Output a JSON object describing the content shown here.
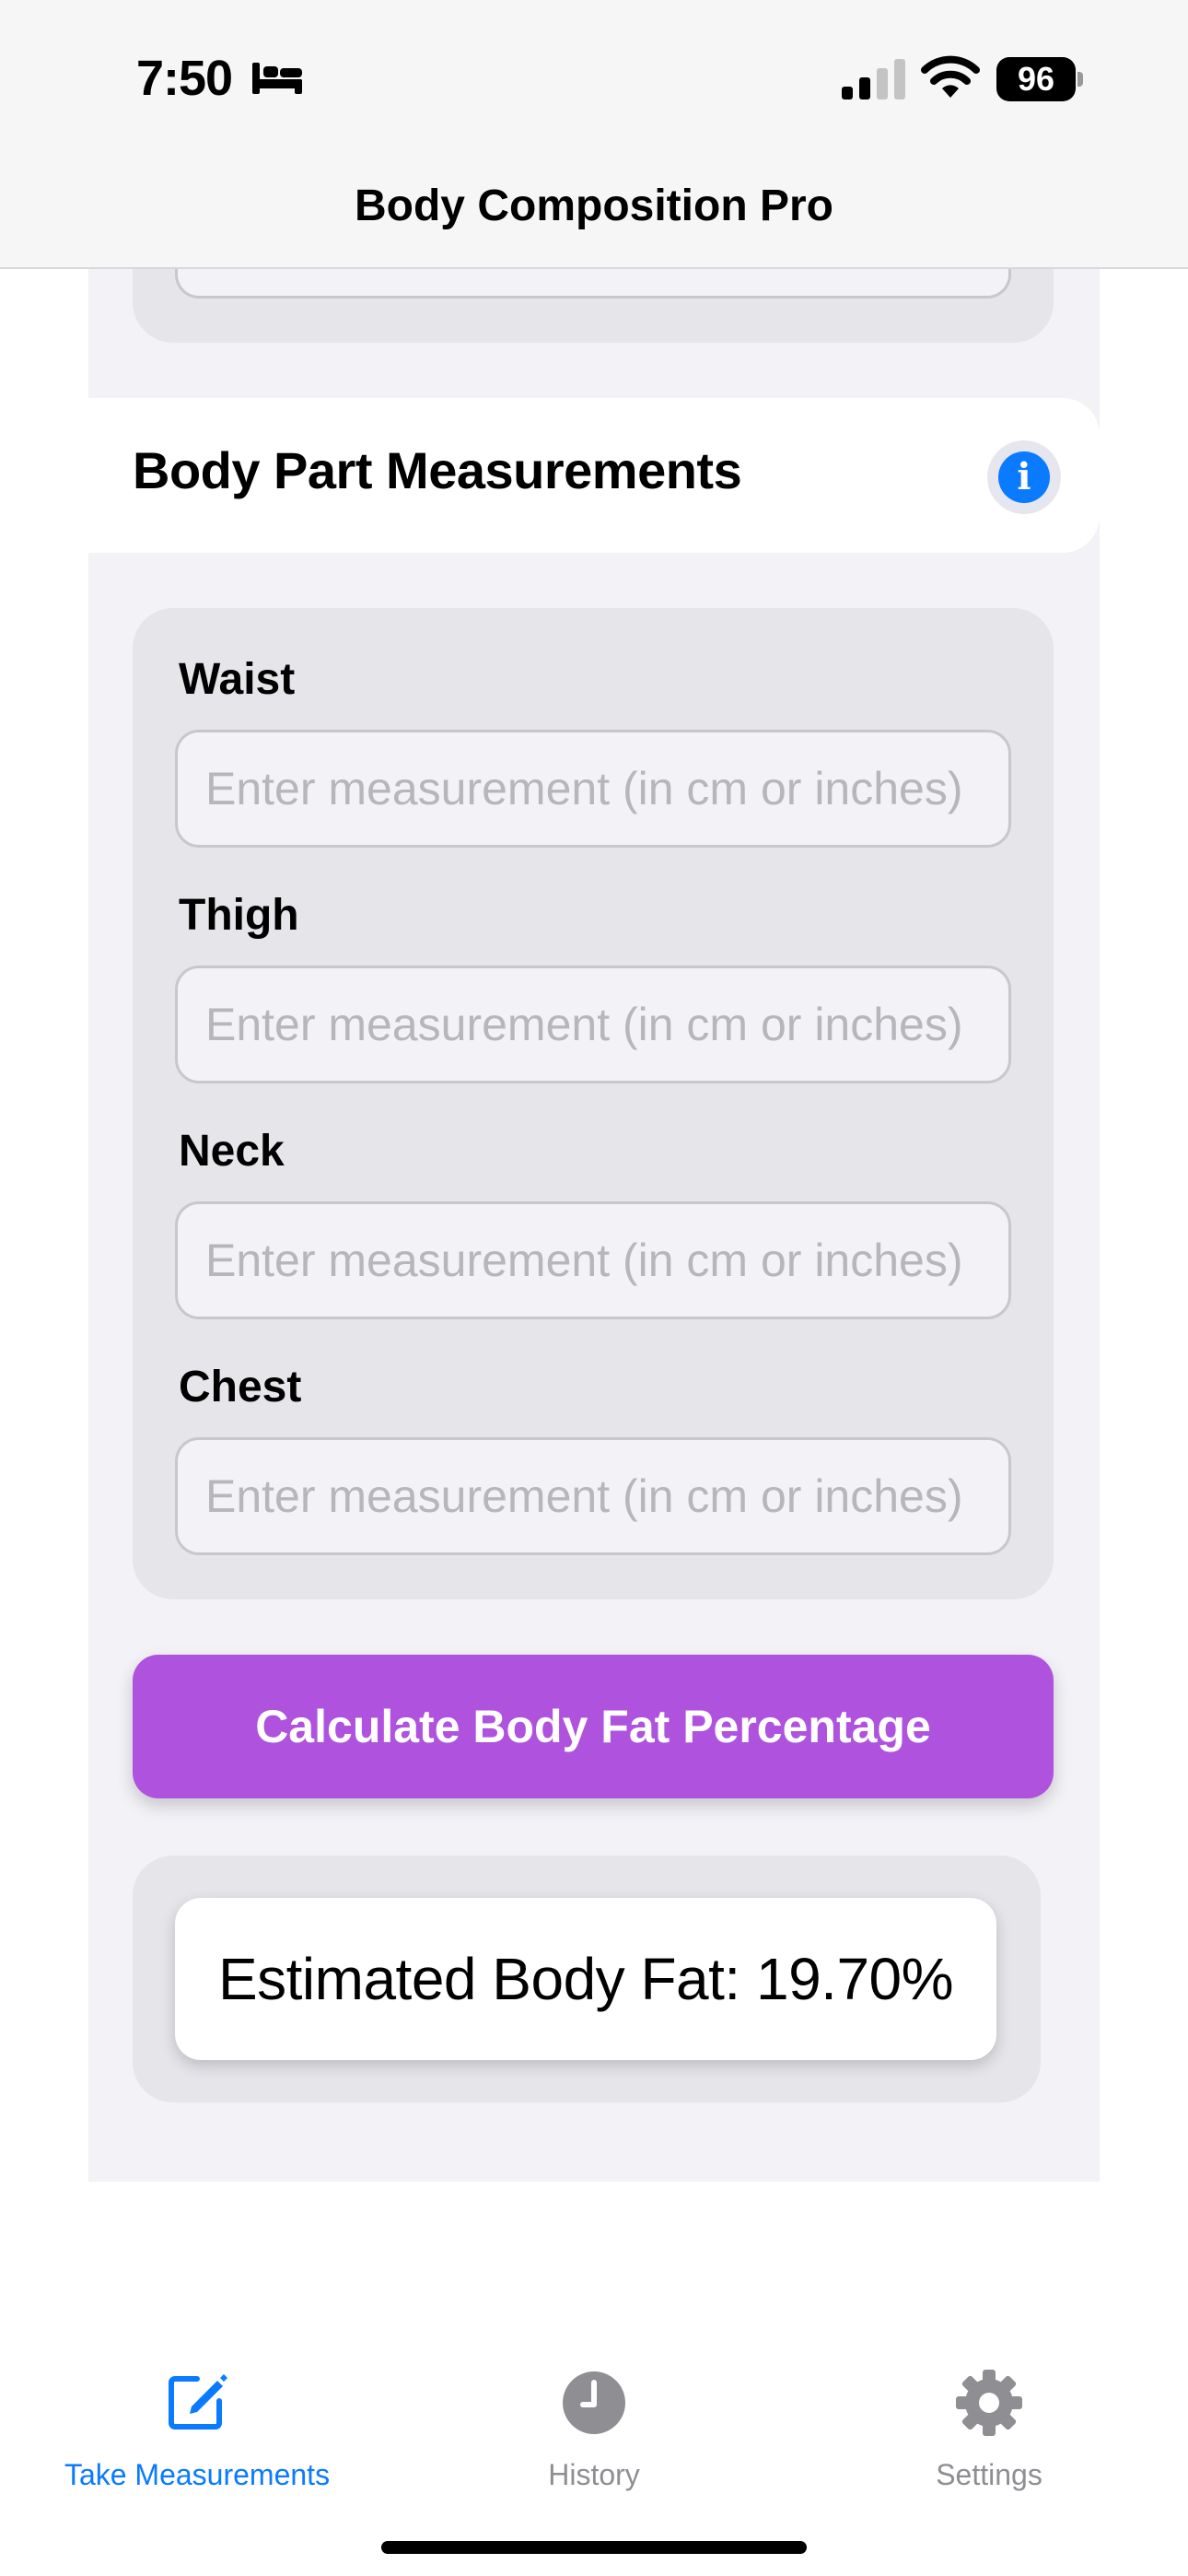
{
  "status_bar": {
    "time": "7:50",
    "battery": "96",
    "icons": [
      "bed-icon",
      "cellular-signal-icon",
      "wifi-icon",
      "battery-icon"
    ]
  },
  "header": {
    "title": "Body Composition Pro"
  },
  "section": {
    "title": "Body Part Measurements",
    "info_icon": "info-circle-icon"
  },
  "fields": [
    {
      "label": "Waist",
      "placeholder": "Enter measurement (in cm or inches)",
      "value": ""
    },
    {
      "label": "Thigh",
      "placeholder": "Enter measurement (in cm or inches)",
      "value": ""
    },
    {
      "label": "Neck",
      "placeholder": "Enter measurement (in cm or inches)",
      "value": ""
    },
    {
      "label": "Chest",
      "placeholder": "Enter measurement (in cm or inches)",
      "value": ""
    }
  ],
  "calculate_button": {
    "label": "Calculate Body Fat Percentage"
  },
  "result": {
    "text": "Estimated Body Fat: 19.70%"
  },
  "tabs": [
    {
      "label": "Take Measurements",
      "icon": "square-pencil-icon",
      "active": true
    },
    {
      "label": "History",
      "icon": "clock-icon",
      "active": false
    },
    {
      "label": "Settings",
      "icon": "gear-icon",
      "active": false
    }
  ],
  "colors": {
    "accent_blue": "#0a7aff",
    "button_purple": "#af52de",
    "card_gray": "#e5e5ea",
    "background": "#f2f2f7"
  }
}
